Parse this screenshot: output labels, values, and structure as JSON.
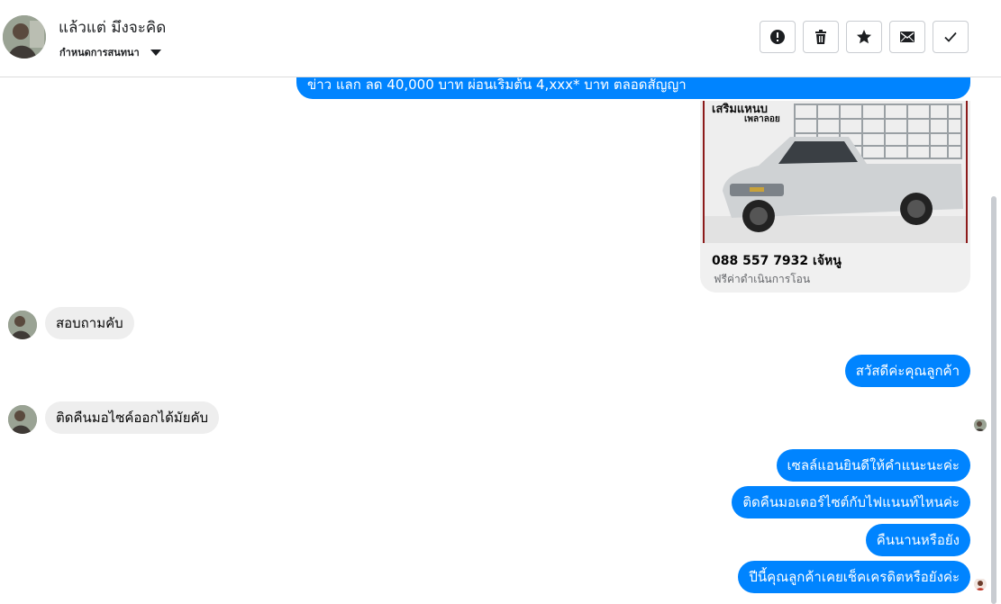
{
  "header": {
    "name": "แล้วแต่ มึงจะคิด",
    "assign_label": "กำหนดการสนทนา",
    "actions": [
      {
        "icon": "alert-icon",
        "label": "Mark as spam"
      },
      {
        "icon": "trash-icon",
        "label": "Delete"
      },
      {
        "icon": "star-icon",
        "label": "Star"
      },
      {
        "icon": "mail-icon",
        "label": "Mark as unread"
      },
      {
        "icon": "check-icon",
        "label": "Mark as done"
      }
    ]
  },
  "conversation": {
    "top_message": "ข่าว แลก ลด 40,000 บาท ผ่อนเริ่มต้น 4,xxx* บาท ตลอดสัญญา",
    "card": {
      "image_caption_line1": "เสริมแหนบ",
      "image_caption_line2": "เพลาลอย",
      "title": "088 557 7932 เจ้หนู",
      "subtitle": "ฟรีค่าดำเนินการโอน"
    },
    "messages": [
      {
        "from": "customer",
        "text": "สอบถามคับ"
      },
      {
        "from": "page",
        "text": "สวัสดีค่ะคุณลูกค้า"
      },
      {
        "from": "customer",
        "text": "ติดคืนมอไซค์ออกได้มัยคับ"
      },
      {
        "from": "page",
        "text": "เซลล์แอนยินดีให้คำแนะนะค่ะ"
      },
      {
        "from": "page",
        "text": "ติดคืนมอเตอร์ไซต์กับไฟแนนท์ไหนค่ะ"
      },
      {
        "from": "page",
        "text": "คืนนานหรือยัง"
      },
      {
        "from": "page",
        "text": "ปีนี้คุณลูกค้าเคยเช็คเครดิตหรือยังค่ะ"
      }
    ]
  },
  "colors": {
    "outgoing_bubble": "#0084ff",
    "incoming_bubble": "#eeeeee",
    "border": "#c9ccd1"
  }
}
